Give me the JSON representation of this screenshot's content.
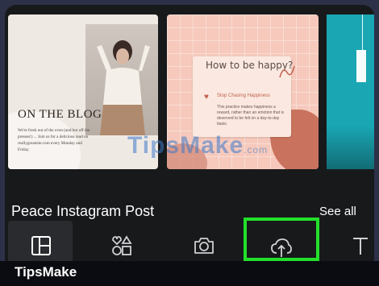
{
  "templates": [
    {
      "name": "blog",
      "title": "ON THE BLOG",
      "body": "We're fresh out of the oven (and hot off the presses!) ... Join us for a delicious read on reallygreatsite.com every Monday and Friday."
    },
    {
      "name": "happy",
      "title": "How to be happy?",
      "subtitle": "Stop Chasing Happiness",
      "body": "This practice makes happiness a reward, rather than an emotion that is deserved to be felt on a day-to-day basis."
    },
    {
      "name": "teal"
    }
  ],
  "watermark": {
    "brand": "TipsMake",
    "suffix": ".com"
  },
  "section": {
    "title": "Peace Instagram Post",
    "see_all": "See all"
  },
  "toolbar": {
    "items": [
      {
        "id": "design",
        "icon": "design-layout-icon",
        "active": true
      },
      {
        "id": "elements",
        "icon": "elements-shapes-icon"
      },
      {
        "id": "photos",
        "icon": "camera-icon"
      },
      {
        "id": "uploads",
        "icon": "cloud-upload-icon",
        "highlighted": true
      },
      {
        "id": "text",
        "icon": "text-icon"
      }
    ],
    "highlight_color": "#22e02a"
  },
  "footer": {
    "brand": "TipsMake"
  }
}
